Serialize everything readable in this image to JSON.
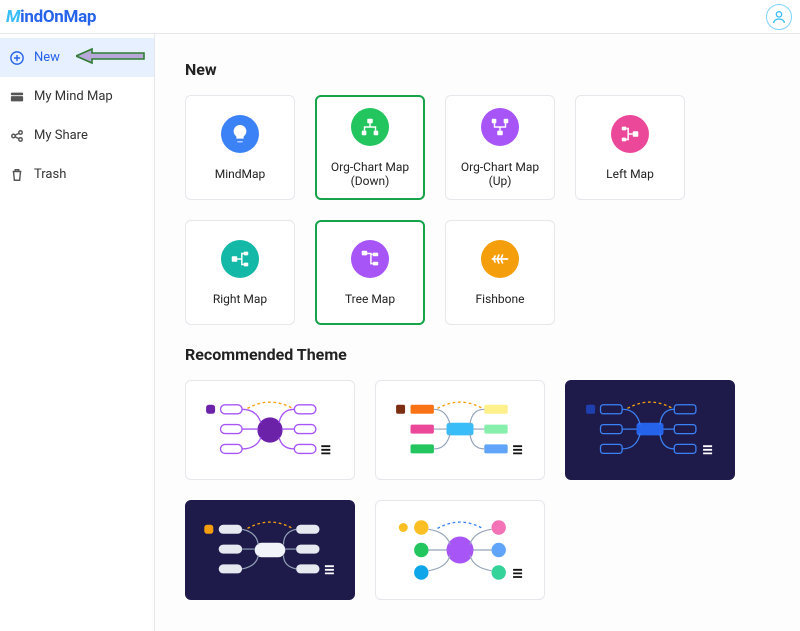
{
  "header": {
    "logo_text": "MindOnMap"
  },
  "sidebar": {
    "items": [
      {
        "label": "New",
        "icon": "plus"
      },
      {
        "label": "My Mind Map",
        "icon": "folder"
      },
      {
        "label": "My Share",
        "icon": "share"
      },
      {
        "label": "Trash",
        "icon": "trash"
      }
    ]
  },
  "sections": {
    "new_title": "New",
    "recommended_title": "Recommended Theme"
  },
  "templates": [
    {
      "label": "MindMap",
      "color": "#3b82f6",
      "icon": "bulb",
      "selected": false
    },
    {
      "label": "Org-Chart Map (Down)",
      "color": "#22c55e",
      "icon": "org-down",
      "selected": true
    },
    {
      "label": "Org-Chart Map (Up)",
      "color": "#a855f7",
      "icon": "org-up",
      "selected": false
    },
    {
      "label": "Left Map",
      "color": "#ec4899",
      "icon": "left",
      "selected": false
    },
    {
      "label": "Right Map",
      "color": "#14b8a6",
      "icon": "right",
      "selected": false
    },
    {
      "label": "Tree Map",
      "color": "#a855f7",
      "icon": "tree",
      "selected": true
    },
    {
      "label": "Fishbone",
      "color": "#f59e0b",
      "icon": "fishbone",
      "selected": false
    }
  ],
  "themes": [
    {
      "style": "purple-outline",
      "bg": "light"
    },
    {
      "style": "color-blocks",
      "bg": "light"
    },
    {
      "style": "blue-dark",
      "bg": "dark"
    },
    {
      "style": "fluid-dark",
      "bg": "dark"
    },
    {
      "style": "pastel-circles",
      "bg": "light"
    }
  ]
}
